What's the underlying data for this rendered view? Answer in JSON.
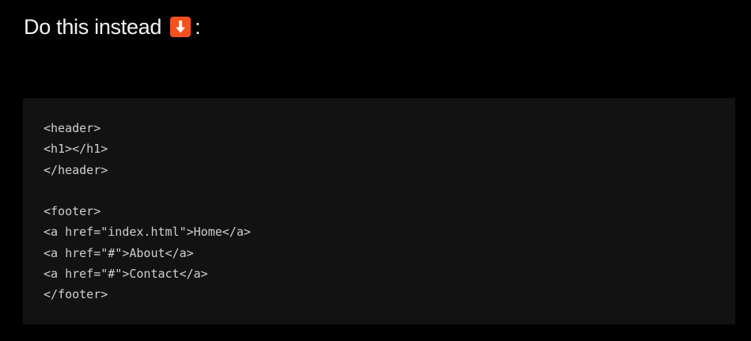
{
  "heading": {
    "text": "Do this instead",
    "icon": "down-arrow-icon",
    "icon_color": "#f4511e",
    "colon": ":"
  },
  "code": {
    "background": "#121212",
    "lines": [
      "<header>",
      "<h1></h1>",
      "</header>",
      "",
      "<footer>",
      "<a href=\"index.html\">Home</a>",
      "<a href=\"#\">About</a>",
      "<a href=\"#\">Contact</a>",
      "</footer>"
    ]
  }
}
